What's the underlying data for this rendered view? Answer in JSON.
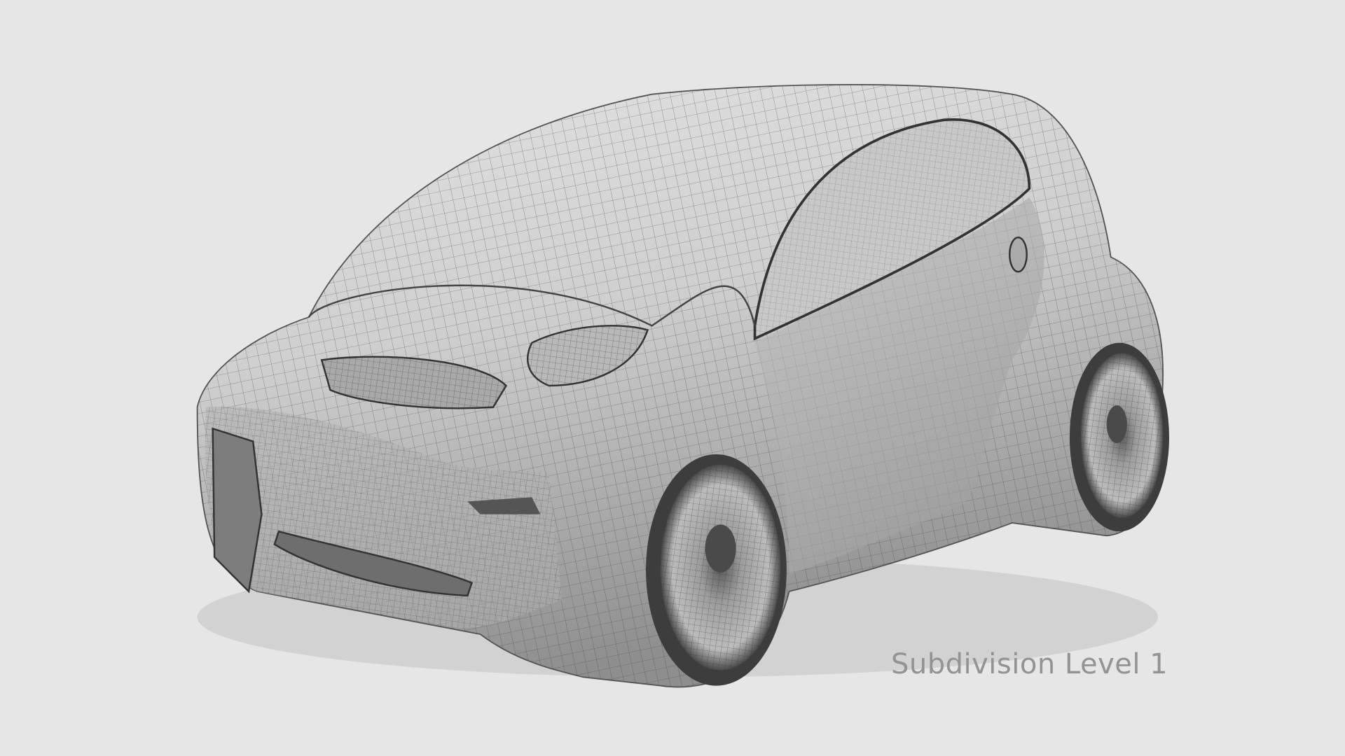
{
  "caption": "Subdivision Level 1",
  "colors": {
    "background": "#e6e6e6",
    "caption": "#939393",
    "mesh_line": "#3a3a3a",
    "body_light": "#dcdcdc",
    "body_dark": "#8c8c8c"
  }
}
